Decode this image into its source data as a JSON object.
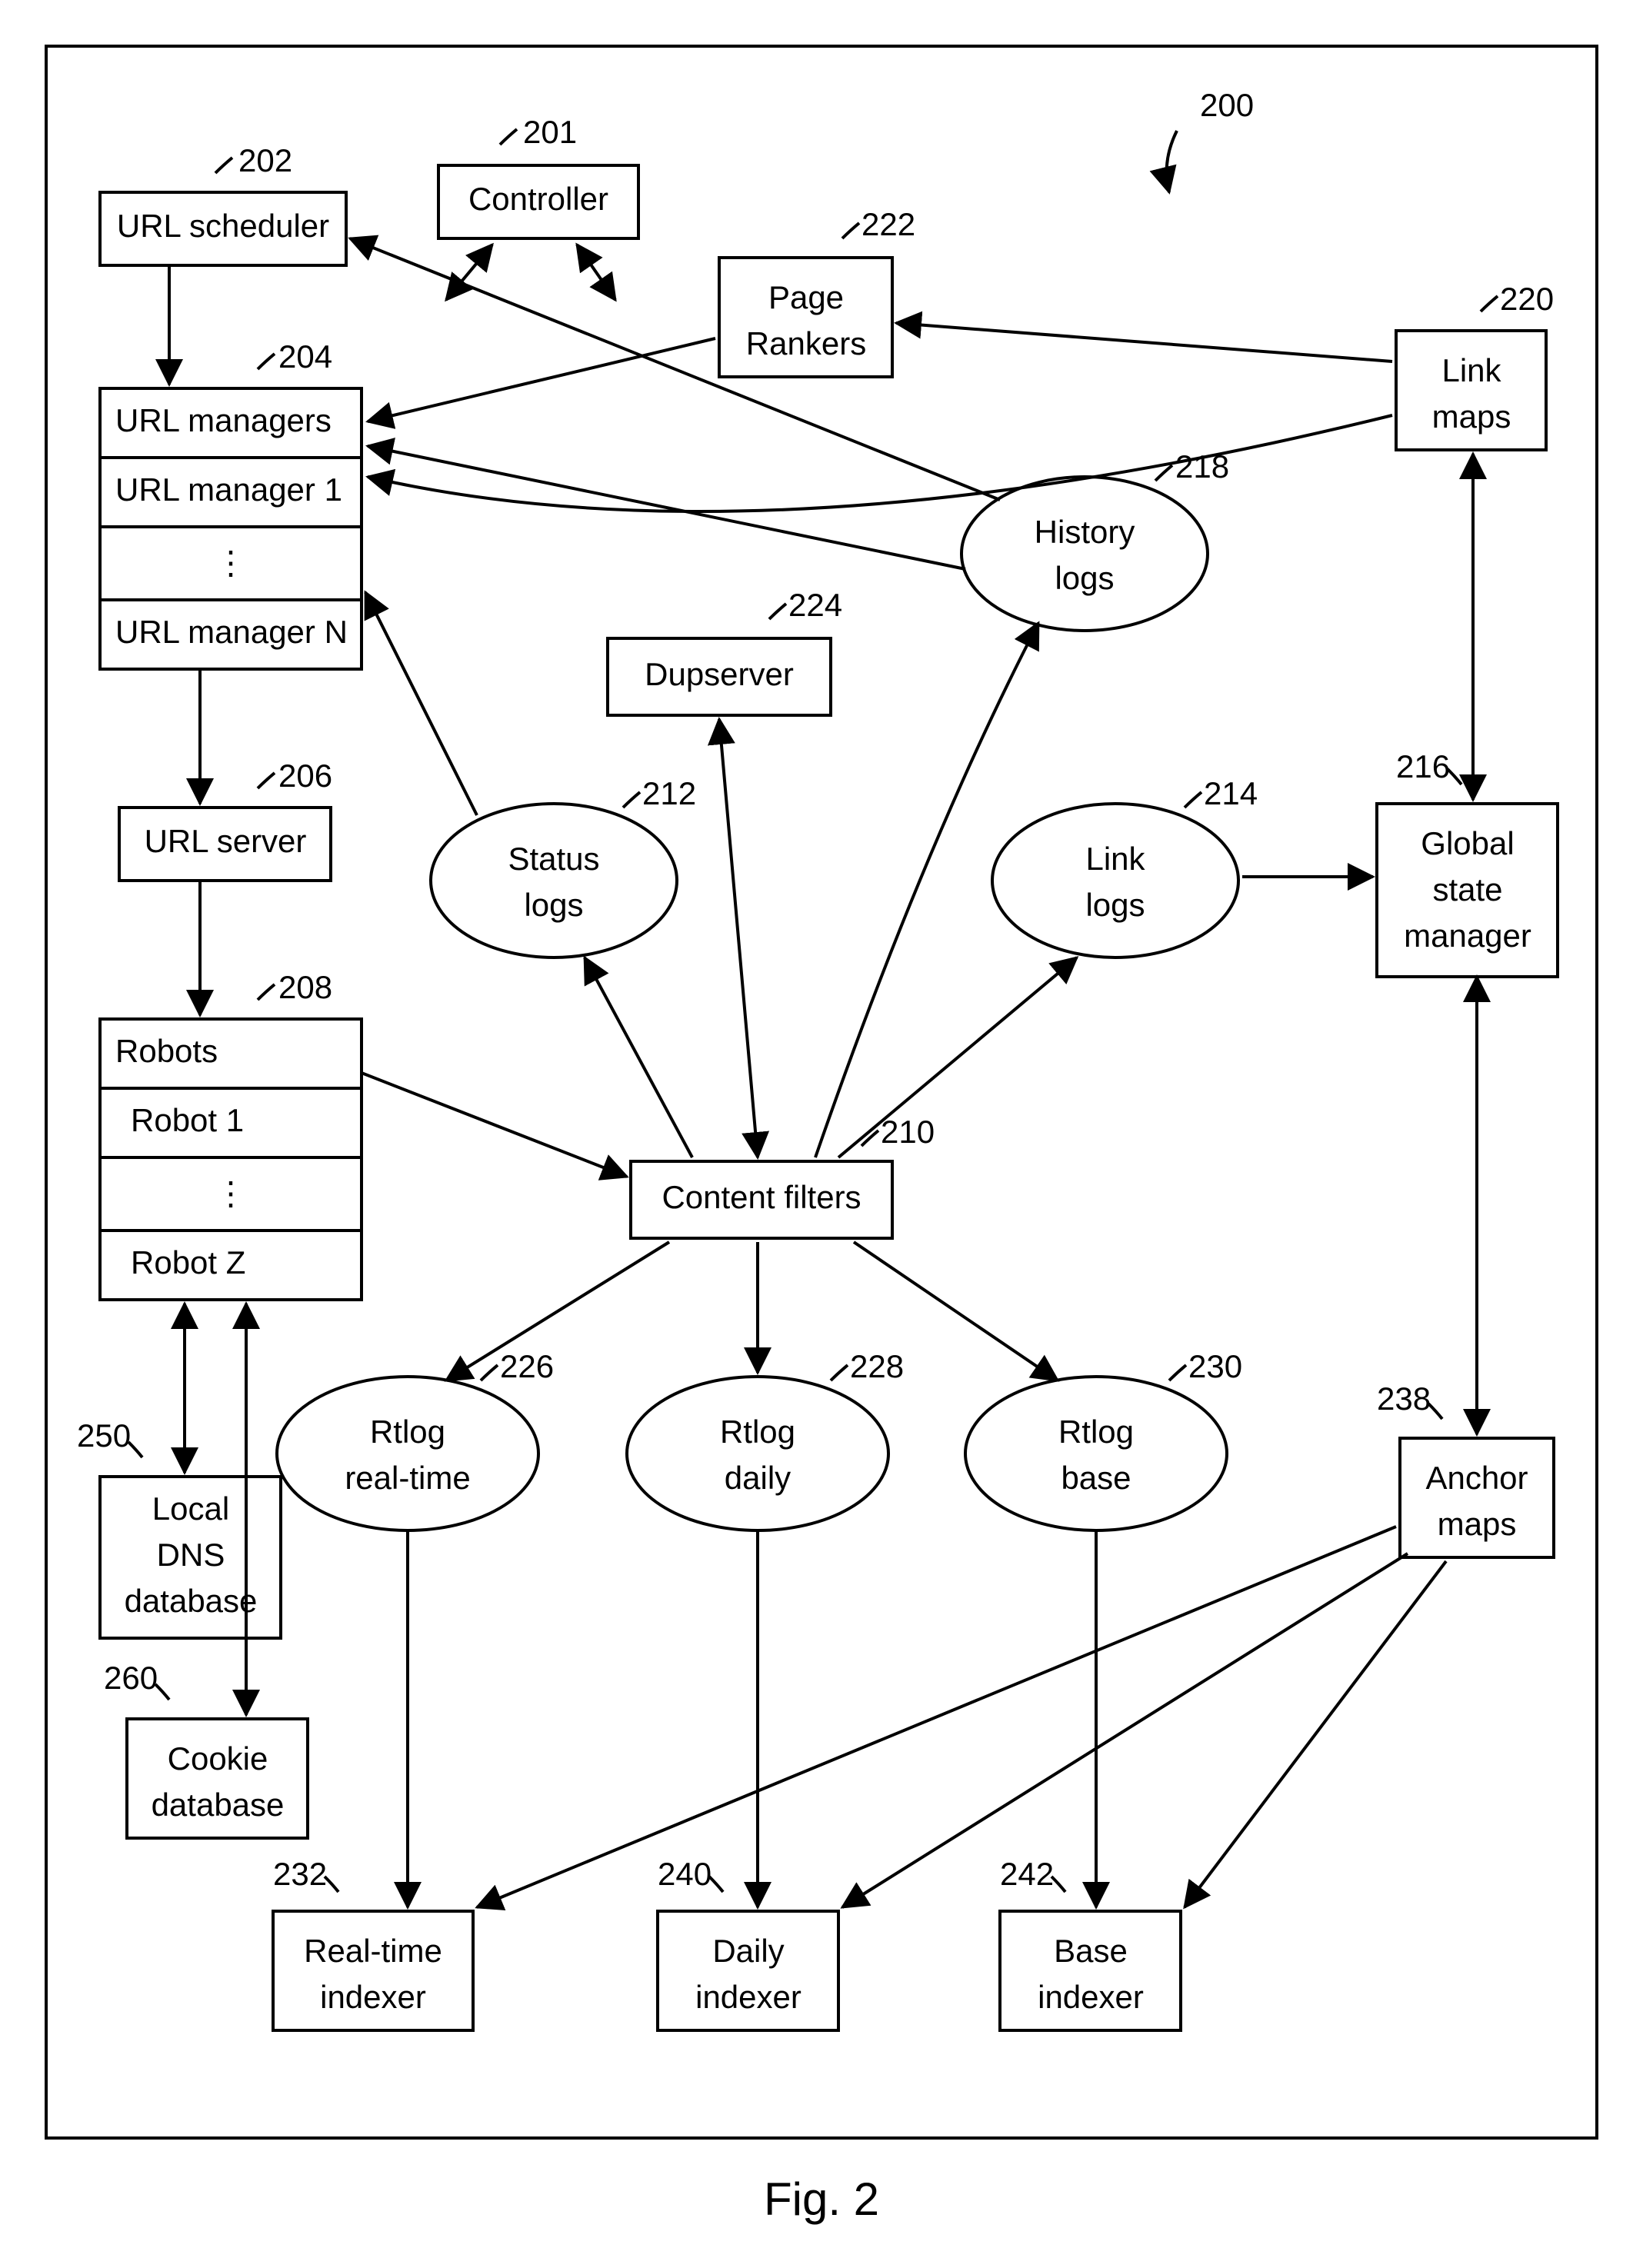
{
  "figure_label": "Fig. 2",
  "system_ref": {
    "num": "200"
  },
  "nodes": {
    "controller": {
      "num": "201",
      "label": "Controller"
    },
    "url_scheduler": {
      "num": "202",
      "label": "URL scheduler"
    },
    "url_managers": {
      "num": "204",
      "label": "URL managers",
      "row1": "URL manager 1",
      "rowN": "URL manager N",
      "dots": "⋮"
    },
    "url_server": {
      "num": "206",
      "label": "URL server"
    },
    "robots": {
      "num": "208",
      "label": "Robots",
      "row1": "Robot 1",
      "rowN": "Robot Z",
      "dots": "⋮"
    },
    "content_filters": {
      "num": "210",
      "label": "Content filters"
    },
    "status_logs": {
      "num": "212",
      "label1": "Status",
      "label2": "logs"
    },
    "link_logs": {
      "num": "214",
      "label1": "Link",
      "label2": "logs"
    },
    "global_state_mgr": {
      "num": "216",
      "label1": "Global",
      "label2": "state",
      "label3": "manager"
    },
    "history_logs": {
      "num": "218",
      "label1": "History",
      "label2": "logs"
    },
    "link_maps": {
      "num": "220",
      "label1": "Link",
      "label2": "maps"
    },
    "page_rankers": {
      "num": "222",
      "label1": "Page",
      "label2": "Rankers"
    },
    "dupserver": {
      "num": "224",
      "label": "Dupserver"
    },
    "rtlog_real": {
      "num": "226",
      "label1": "Rtlog",
      "label2": "real-time"
    },
    "rtlog_daily": {
      "num": "228",
      "label1": "Rtlog",
      "label2": "daily"
    },
    "rtlog_base": {
      "num": "230",
      "label1": "Rtlog",
      "label2": "base"
    },
    "real_indexer": {
      "num": "232",
      "label1": "Real-time",
      "label2": "indexer"
    },
    "anchor_maps": {
      "num": "238",
      "label1": "Anchor",
      "label2": "maps"
    },
    "daily_indexer": {
      "num": "240",
      "label1": "Daily",
      "label2": "indexer"
    },
    "base_indexer": {
      "num": "242",
      "label1": "Base",
      "label2": "indexer"
    },
    "local_dns": {
      "num": "250",
      "label1": "Local",
      "label2": "DNS",
      "label3": "database"
    },
    "cookie_db": {
      "num": "260",
      "label1": "Cookie",
      "label2": "database"
    }
  }
}
